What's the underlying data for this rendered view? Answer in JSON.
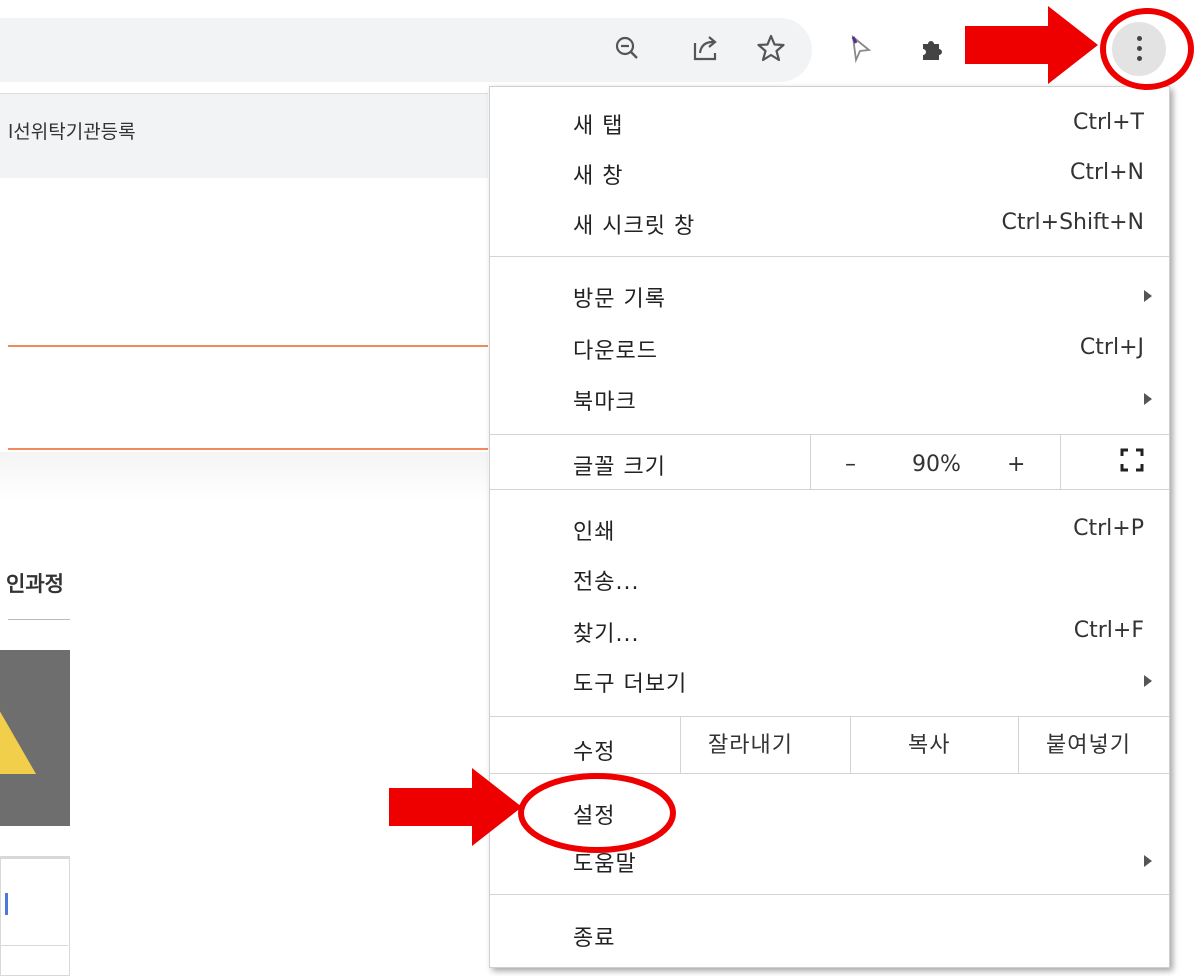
{
  "toolbar": {
    "icons": [
      "zoom-out-icon",
      "share-icon",
      "bookmark-star-icon",
      "cursor-extension-icon",
      "puzzle-extensions-icon",
      "more-menu-icon"
    ]
  },
  "page": {
    "tab_text": "l선위탁기관등록",
    "section_title": "인과정"
  },
  "menu": {
    "new_tab": {
      "label": "새 탭",
      "shortcut": "Ctrl+T"
    },
    "new_window": {
      "label": "새 창",
      "shortcut": "Ctrl+N"
    },
    "incognito": {
      "label": "새 시크릿 창",
      "shortcut": "Ctrl+Shift+N"
    },
    "history": {
      "label": "방문 기록"
    },
    "downloads": {
      "label": "다운로드",
      "shortcut": "Ctrl+J"
    },
    "bookmarks": {
      "label": "북마크"
    },
    "zoom": {
      "label": "글꼴 크기",
      "minus": "–",
      "value": "90%",
      "plus": "+"
    },
    "print": {
      "label": "인쇄",
      "shortcut": "Ctrl+P"
    },
    "cast": {
      "label": "전송..."
    },
    "find": {
      "label": "찾기...",
      "shortcut": "Ctrl+F"
    },
    "more_tools": {
      "label": "도구 더보기"
    },
    "edit": {
      "label": "수정",
      "cut": "잘라내기",
      "copy": "복사",
      "paste": "붙여넣기"
    },
    "settings": {
      "label": "설정"
    },
    "help": {
      "label": "도움말"
    },
    "exit": {
      "label": "종료"
    }
  },
  "colors": {
    "annotation_red": "#ee0000",
    "orange_line": "#f08a5d"
  }
}
